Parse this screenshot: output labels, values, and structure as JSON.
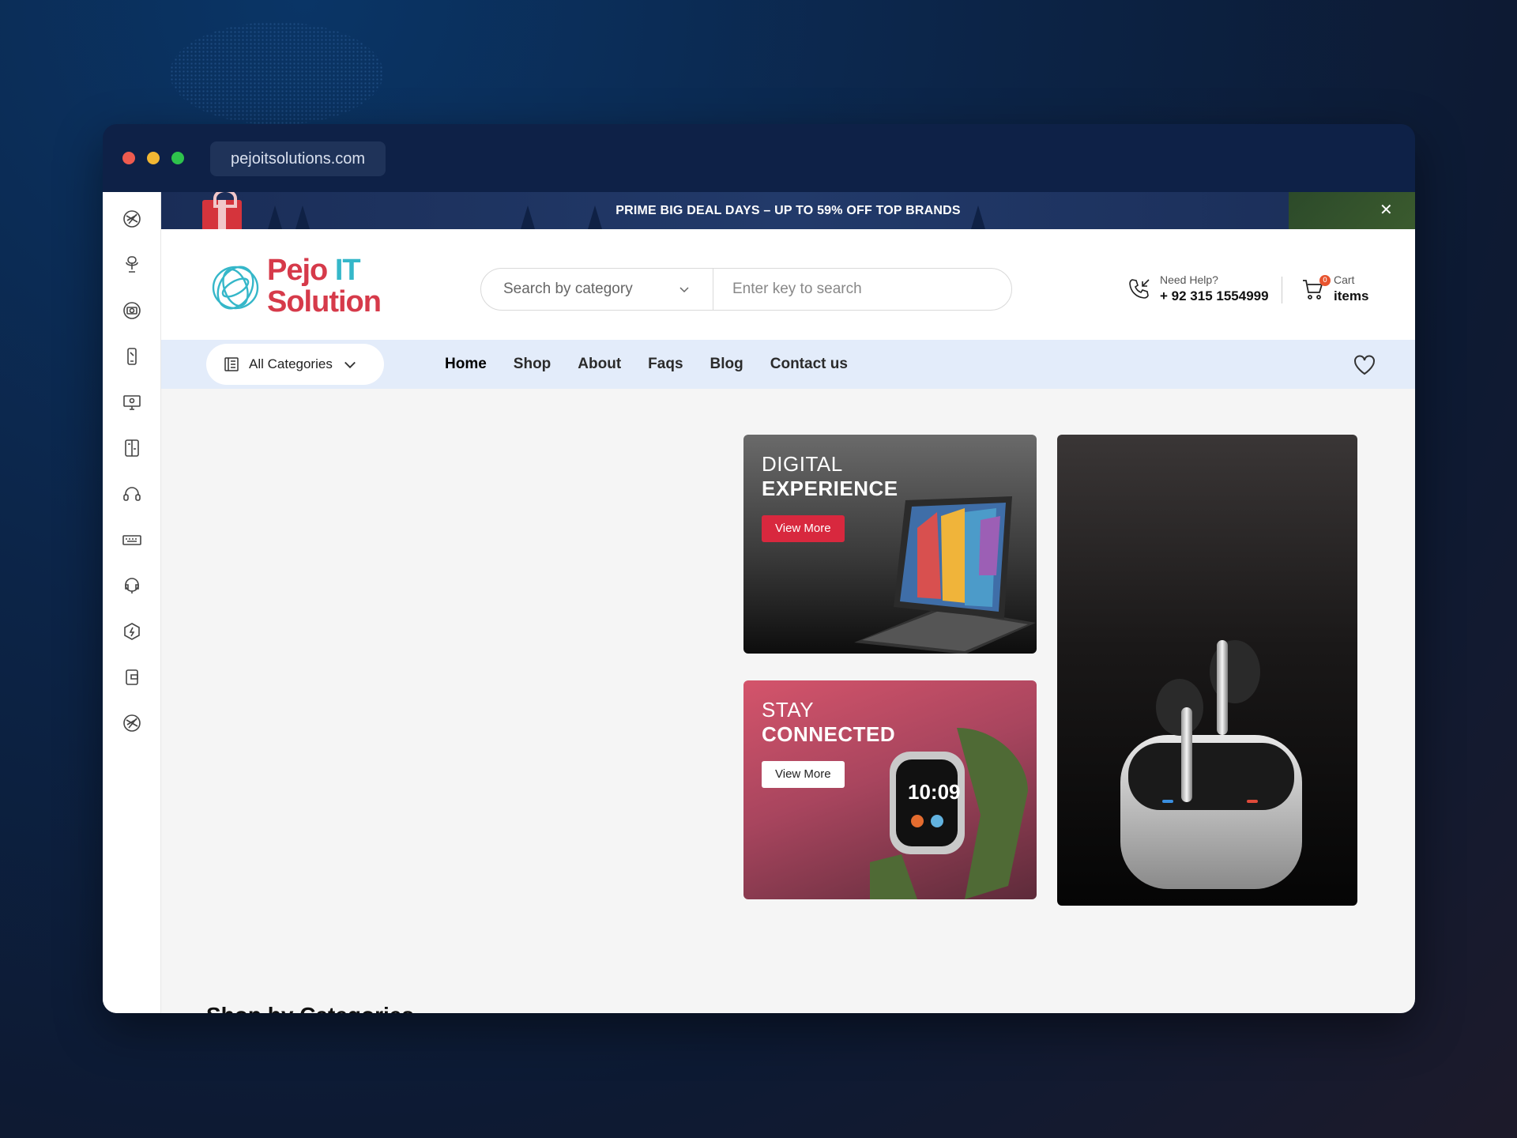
{
  "browser": {
    "url": "pejoitsolutions.com"
  },
  "promo_bar": {
    "text": "PRIME BIG DEAL DAYS – UP TO 59% OFF TOP BRANDS"
  },
  "logo": {
    "line1_a": "Pejo",
    "line1_b": "IT",
    "line2": "Solution"
  },
  "search": {
    "category_label": "Search by category",
    "placeholder": "Enter key to search"
  },
  "help": {
    "label": "Need Help?",
    "phone": "+ 92 315 1554999"
  },
  "cart": {
    "label": "Cart",
    "items_label": "items",
    "count": "0"
  },
  "nav": {
    "all_categories": "All Categories",
    "links": [
      "Home",
      "Shop",
      "About",
      "Faqs",
      "Blog",
      "Contact us"
    ]
  },
  "banners": {
    "digital": {
      "line1": "DIGITAL",
      "line2": "EXPERIENCE",
      "button": "View More"
    },
    "connected": {
      "line1": "STAY",
      "line2": "CONNECTED",
      "button": "View More"
    }
  },
  "sections": {
    "shop_by_categories": "Shop by Categories"
  },
  "sidebar_icons": [
    "laptop-icon",
    "microphone-icon",
    "camera-icon",
    "phone-icon",
    "monitor-icon",
    "tablet-icon",
    "headphones-icon",
    "keyboard-icon",
    "headset-icon",
    "power-bank-icon",
    "wallet-icon",
    "laptop-icon"
  ],
  "colors": {
    "accent_red": "#d8283e",
    "nav_bg": "#e3ecfa",
    "logo_teal": "#35b7c9",
    "logo_red": "#d63a4a"
  }
}
